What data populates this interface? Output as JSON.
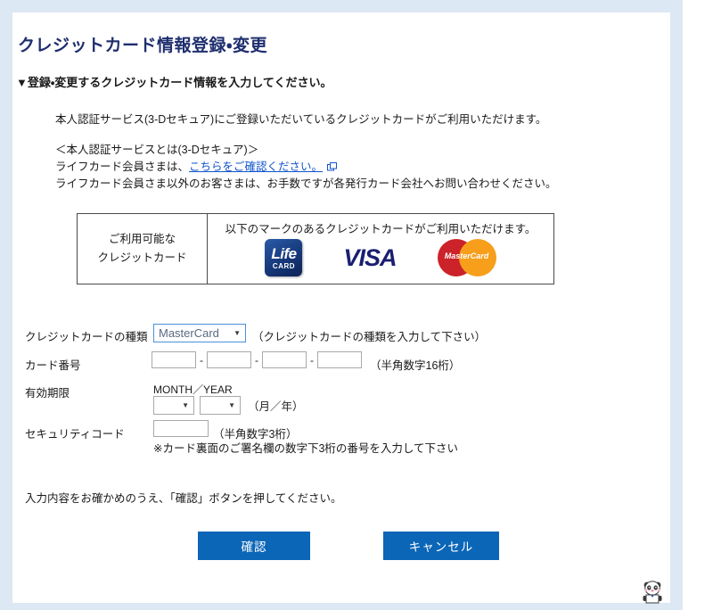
{
  "page": {
    "title": "クレジットカード情報登録・変更",
    "intro_heading": "▼登録・変更するクレジットカード情報を入力してください。"
  },
  "description": {
    "main": "本人認証サービス(3-Dセキュア)にご登録いただいているクレジットカードがご利用いただけます。",
    "what_is": "＜本人認証サービスとは(3-Dセキュア)＞",
    "member_prefix": "ライフカード会員さまは、",
    "member_link": "こちらをご確認ください。",
    "member_link_icon": "external-link-icon",
    "non_member": "ライフカード会員さま以外のお客さまは、お手数ですが各発行カード会社へお問い合わせください。"
  },
  "card_table": {
    "label_line1": "ご利用可能な",
    "label_line2": "クレジットカード",
    "caption": "以下のマークのあるクレジットカードがご利用いただけます。",
    "logos": [
      {
        "name": "lifecard-logo",
        "main": "Life",
        "sub": "CARD",
        "color": "#16387a"
      },
      {
        "name": "visa-logo",
        "text": "VISA",
        "color": "#1a1f71"
      },
      {
        "name": "mastercard-logo",
        "text": "MasterCard",
        "color_left": "#cc2229",
        "color_right": "#f79e1b"
      }
    ]
  },
  "form": {
    "card_type": {
      "label": "クレジットカードの種類",
      "value": "MasterCard",
      "hint": "（クレジットカードの種類を入力して下さい）",
      "arrow": "▼"
    },
    "card_number": {
      "label": "カード番号",
      "values": [
        "",
        "",
        "",
        ""
      ],
      "separator": "-",
      "hint": "（半角数字16桁）"
    },
    "expiry": {
      "label": "有効期限",
      "caption": "MONTH／YEAR",
      "month_value": "",
      "year_value": "",
      "hint": "（月／年）",
      "arrow": "▼"
    },
    "security_code": {
      "label": "セキュリティコード",
      "value": "",
      "hint": "（半角数字3桁）",
      "note": "※カード裏面のご署名欄の数字下3桁の番号を入力して下さい"
    }
  },
  "footer": {
    "instruction": "入力内容をお確かめのうえ、「確認」ボタンを押してください。",
    "confirm_label": "確認",
    "cancel_label": "キャンセル",
    "button_color": "#0b66b8"
  },
  "mascot": {
    "name": "panda-mascot"
  }
}
